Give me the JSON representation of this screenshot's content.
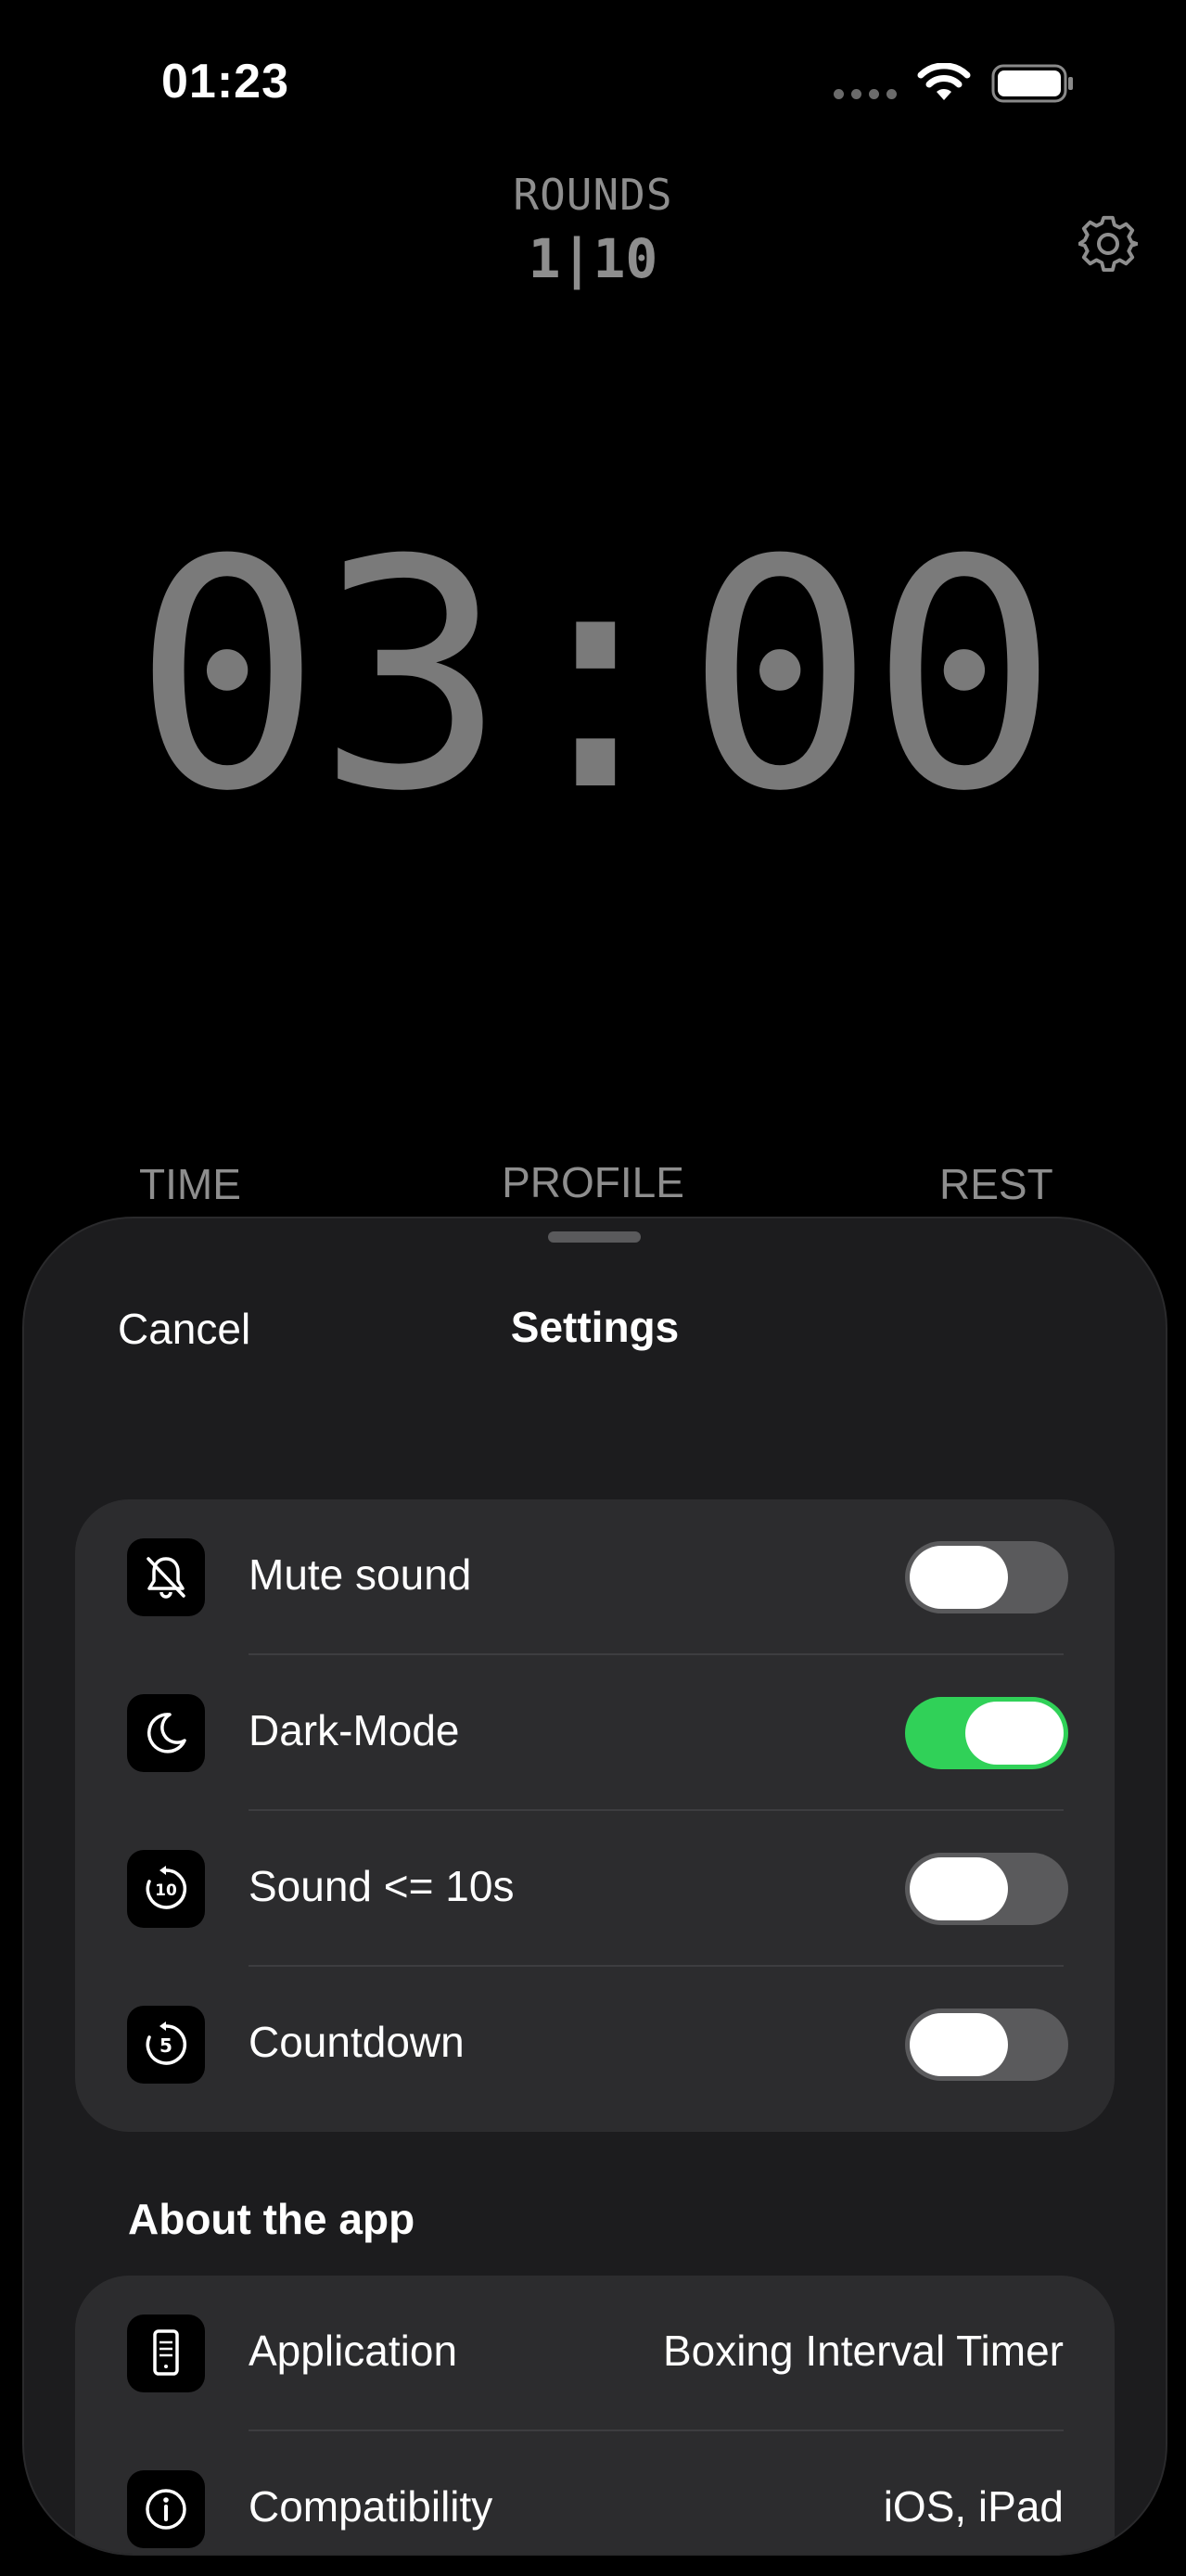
{
  "status_bar": {
    "time": "01:23",
    "icons": [
      "cellular-signal-icon",
      "wifi-icon",
      "battery-icon"
    ]
  },
  "header": {
    "rounds_label": "ROUNDS",
    "rounds_value": "1|10",
    "settings_icon": "gear-icon"
  },
  "timer": {
    "display": "03:00"
  },
  "bottom_labels": {
    "time": "TIME",
    "profile": "PROFILE",
    "rest": "REST"
  },
  "sheet": {
    "cancel_label": "Cancel",
    "title": "Settings",
    "settings_rows": [
      {
        "label": "Mute sound",
        "icon": "bell-slash-icon",
        "enabled": false
      },
      {
        "label": "Dark-Mode",
        "icon": "moon-icon",
        "enabled": true
      },
      {
        "label": "Sound <= 10s",
        "icon": "timer-10-icon",
        "enabled": false
      },
      {
        "label": "Countdown",
        "icon": "timer-5-icon",
        "enabled": false
      }
    ],
    "about_header": "About the app",
    "about_rows": [
      {
        "label": "Application",
        "value": "Boxing Interval Timer",
        "icon": "device-icon"
      },
      {
        "label": "Compatibility",
        "value": "iOS, iPad",
        "icon": "info-icon"
      }
    ]
  },
  "colors": {
    "background": "#000000",
    "sheet": "#1c1c1e",
    "group": "#2c2c2e",
    "toggle_on": "#30d158",
    "toggle_off": "#5a5a5c",
    "dim_text": "#8e8e8e"
  }
}
